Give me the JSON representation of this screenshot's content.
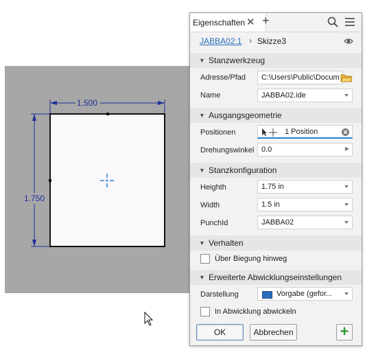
{
  "sketch": {
    "width_dim": "1.500",
    "height_dim": "1.750"
  },
  "panel": {
    "tab_title": "Eigenschaften",
    "breadcrumb": {
      "part": "JABBA02:1",
      "sketch": "Skizze3"
    },
    "sections": {
      "stanzwerkzeug": "Stanzwerkzeug",
      "ausgangsgeometrie": "Ausgangsgeometrie",
      "stanzkonfiguration": "Stanzkonfiguration",
      "verhalten": "Verhalten",
      "erweitert": "Erweiterte Abwicklungseinstellungen"
    },
    "fields": {
      "adresse": {
        "label": "Adresse/Pfad",
        "value": "C:\\Users\\Public\\Docum"
      },
      "name": {
        "label": "Name",
        "value": "JABBA02.ide"
      },
      "positionen": {
        "label": "Positionen",
        "value": "1 Position"
      },
      "drehungswinkel": {
        "label": "Drehungswinkel",
        "value": "0.0"
      },
      "height": {
        "label": "Heighth",
        "value": "1.75 in"
      },
      "width": {
        "label": "Width",
        "value": "1.5 in"
      },
      "punchid": {
        "label": "PunchId",
        "value": "JABBA02"
      },
      "darstellung": {
        "label": "Darstellung",
        "value": "Vorgabe (gefor..."
      }
    },
    "checkboxes": {
      "biegung": {
        "label": "Über Biegung hinweg",
        "checked": false
      },
      "abwicklung": {
        "label": "In Abwicklung abwickeln",
        "checked": false
      }
    },
    "buttons": {
      "ok": "OK",
      "cancel": "Abbrechen",
      "add": "+"
    }
  },
  "colors": {
    "canvas_bg": "#a7a7a7",
    "dimension_blue": "#1f2f9a",
    "accent_blue": "#2a6ebb",
    "add_green": "#2e9b3a"
  }
}
